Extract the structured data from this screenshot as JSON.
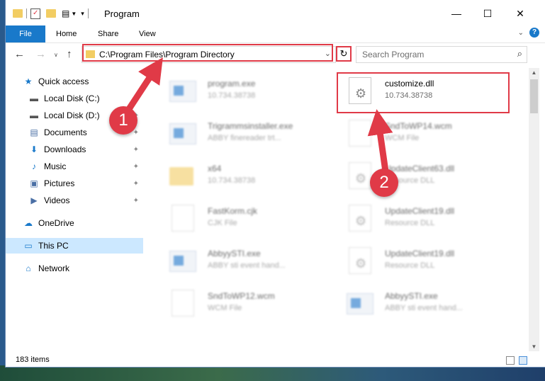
{
  "window": {
    "title": "Program"
  },
  "ribbon": {
    "file": "File",
    "home": "Home",
    "share": "Share",
    "view": "View"
  },
  "nav": {
    "address": "C:\\Program Files\\Program Directory",
    "search_placeholder": "Search Program"
  },
  "sidebar": {
    "items": [
      {
        "label": "Quick access",
        "icon": "star-icon"
      },
      {
        "label": "Local Disk (C:)",
        "icon": "drive-icon",
        "pinned": true
      },
      {
        "label": "Local Disk (D:)",
        "icon": "drive-icon",
        "pinned": true
      },
      {
        "label": "Documents",
        "icon": "documents-icon",
        "pinned": true
      },
      {
        "label": "Downloads",
        "icon": "downloads-icon",
        "pinned": true
      },
      {
        "label": "Music",
        "icon": "music-icon",
        "pinned": true
      },
      {
        "label": "Pictures",
        "icon": "pictures-icon",
        "pinned": true
      },
      {
        "label": "Videos",
        "icon": "videos-icon",
        "pinned": true
      },
      {
        "label": "OneDrive",
        "icon": "cloud-icon"
      },
      {
        "label": "This PC",
        "icon": "computer-icon",
        "selected": true
      },
      {
        "label": "Network",
        "icon": "network-icon"
      }
    ]
  },
  "files": {
    "left": [
      {
        "name": "program.exe",
        "sub": "10.734.38738",
        "kind": "exe-setup"
      },
      {
        "name": "Trigrammsinstaller.exe",
        "sub": "ABBY finereader trt...",
        "kind": "exe"
      },
      {
        "name": "x64",
        "sub": "10.734.38738",
        "kind": "folder"
      },
      {
        "name": "FastKorm.cjk",
        "sub": "CJK File",
        "kind": "page"
      },
      {
        "name": "AbbyySTI.exe",
        "sub": "ABBY sti event hand...",
        "kind": "exe"
      },
      {
        "name": "SndToWP12.wcm",
        "sub": "WCM File",
        "kind": "page"
      }
    ],
    "right": [
      {
        "name": "customize.dll",
        "sub": "10.734.38738",
        "kind": "dll",
        "highlight": true
      },
      {
        "name": "SndToWP14.wcm",
        "sub": "WCM File",
        "kind": "page"
      },
      {
        "name": "UpdateClient63.dll",
        "sub": "Resource DLL",
        "kind": "dll"
      },
      {
        "name": "UpdateClient19.dll",
        "sub": "Resource DLL",
        "kind": "dll"
      },
      {
        "name": "UpdateClient19.dll",
        "sub": "Resource DLL",
        "kind": "dll"
      },
      {
        "name": "AbbyySTI.exe",
        "sub": "ABBY sti event hand...",
        "kind": "exe"
      }
    ]
  },
  "status": {
    "items": "183 items"
  },
  "annotations": {
    "step1": "1",
    "step2": "2",
    "color": "#e03a47"
  }
}
